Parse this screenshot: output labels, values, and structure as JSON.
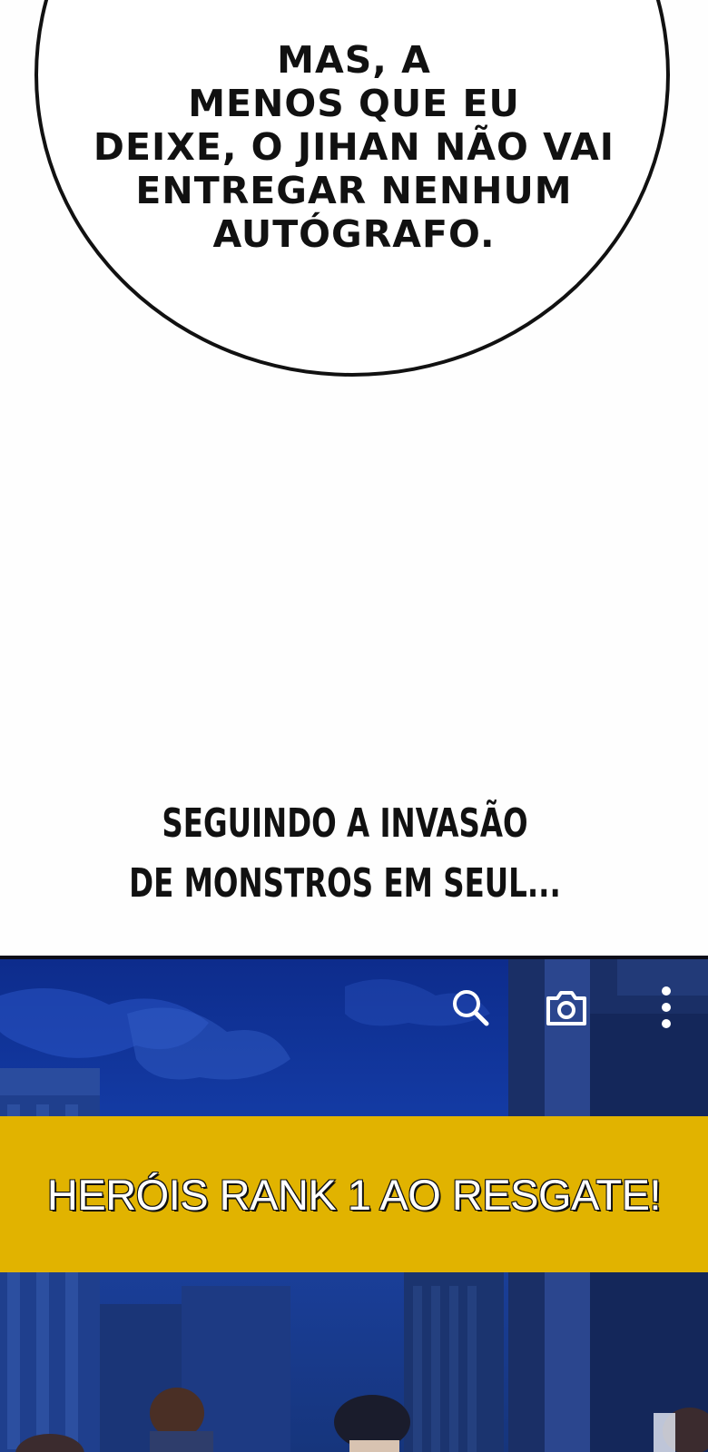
{
  "speech_bubble": {
    "text": "MAS, A\nMENOS QUE EU\nDEIXE, O JIHAN NÃO VAI\nENTREGAR NENHUM\nAUTÓGRAFO."
  },
  "narration": {
    "text": "SEGUINDO A INVASÃO\nDE MONSTROS EM SEUL..."
  },
  "toolbar": {
    "search_icon": "search-icon",
    "camera_icon": "camera-icon",
    "more_icon": "more-vertical-icon"
  },
  "banner": {
    "text": "HERÓIS RANK 1 AO RESGATE!",
    "color": "#e1b300"
  },
  "colors": {
    "panel_sky": "#143ca6",
    "banner_yellow": "#e1b300"
  }
}
